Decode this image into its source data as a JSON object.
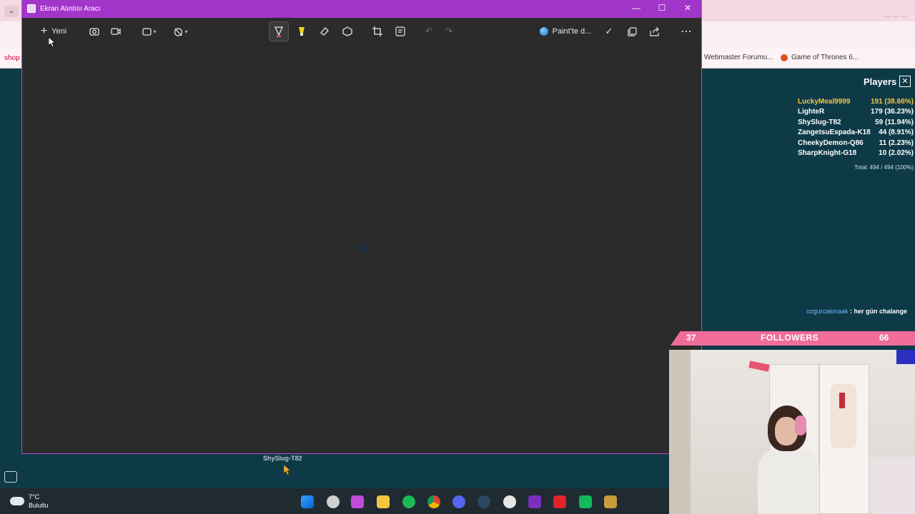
{
  "snip": {
    "title": "Ekran Alıntısı Aracı",
    "new_label": "Yeni",
    "paint_label": "Paint'te d..."
  },
  "browser": {
    "bookmark_left": "shop",
    "bookmarks": [
      "Webmaster Forumu...",
      "Game of Thrones 6..."
    ]
  },
  "players": {
    "title": "Players",
    "rows": [
      {
        "name": "LuckyMeal9999",
        "score": "191 (38.66%)",
        "color": "#f5c542"
      },
      {
        "name": "LighteR",
        "score": "179 (36.23%)",
        "color": "#ffffff"
      },
      {
        "name": "ShySlug-T82",
        "score": "59 (11.94%)",
        "color": "#ffffff"
      },
      {
        "name": "ZangetsuEspada-K18",
        "score": "44 (8.91%)",
        "color": "#ffffff"
      },
      {
        "name": "CheekyDemon-Q86",
        "score": "11 (2.23%)",
        "color": "#ffffff"
      },
      {
        "name": "SharpKnight-G18",
        "score": "10 (2.02%)",
        "color": "#ffffff"
      }
    ],
    "total": "Total: 494 / 494 (100%)"
  },
  "chat": {
    "user": "ozgurcakmaak",
    "text": ": her gün chalange"
  },
  "followers": {
    "left_count": "37",
    "title": "FOLLOWERS",
    "right_count": "66"
  },
  "cursor_label": "ShySlug-T82",
  "weather": {
    "temp": "7°C",
    "condition": "Bulutlu"
  },
  "colors": {
    "snip_title": "#a236c9",
    "followers_bar": "#f06c9b",
    "top_player": "#f5c542"
  }
}
